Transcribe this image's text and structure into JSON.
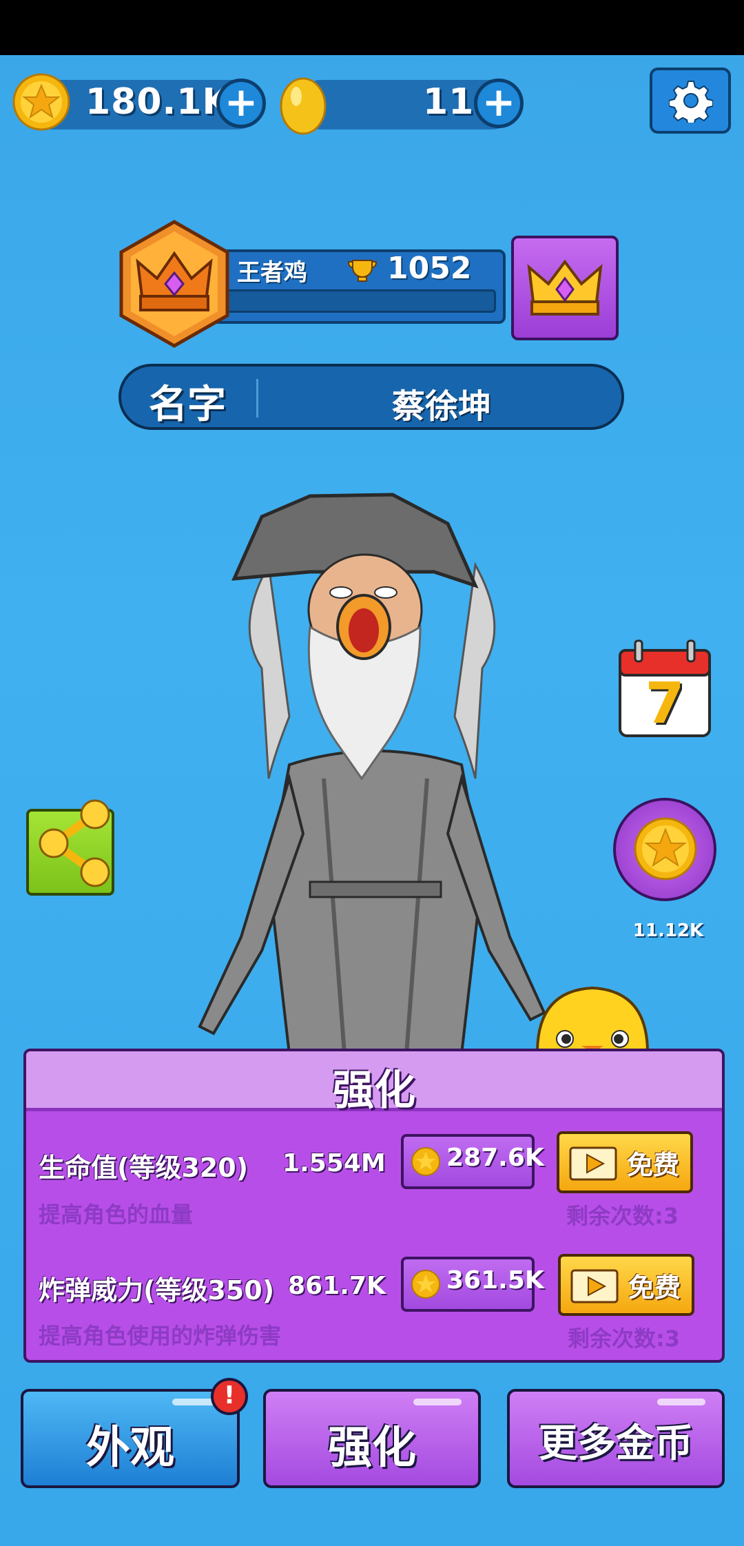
{
  "colors": {
    "background": "#3aa6e8",
    "accent_purple": "#b84ee8",
    "accent_yellow": "#f5a70f",
    "dark_outline": "#0c3f6e"
  },
  "currency": {
    "coins": {
      "icon": "star-coin-icon",
      "value": "180.1K"
    },
    "gems": {
      "icon": "golden-egg-icon",
      "value": "11"
    }
  },
  "header": {
    "settings_icon": "gear-icon"
  },
  "player": {
    "rank_name": "王者鸡",
    "trophy_icon": "trophy-icon",
    "trophies": "1052",
    "xp_progress": 0.02
  },
  "name_bar": {
    "label": "名字",
    "value": "蔡徐坤"
  },
  "side": {
    "share_icon": "share-icon",
    "calendar_day": "7",
    "coin_reward": "11.12K"
  },
  "upgrade_panel": {
    "title": "强化",
    "rows": [
      {
        "label": "生命值(等级320)",
        "value": "1.554M",
        "desc": "提高角色的血量",
        "cost": "287.6K",
        "free_label": "免费",
        "remaining": "剩余次数:3"
      },
      {
        "label": "炸弹威力(等级350)",
        "value": "861.7K",
        "desc": "提高角色使用的炸弹伤害",
        "cost": "361.5K",
        "free_label": "免费",
        "remaining": "剩余次数:3"
      }
    ]
  },
  "bottom_nav": {
    "appearance": "外观",
    "upgrade": "强化",
    "more_coins": "更多金币"
  }
}
